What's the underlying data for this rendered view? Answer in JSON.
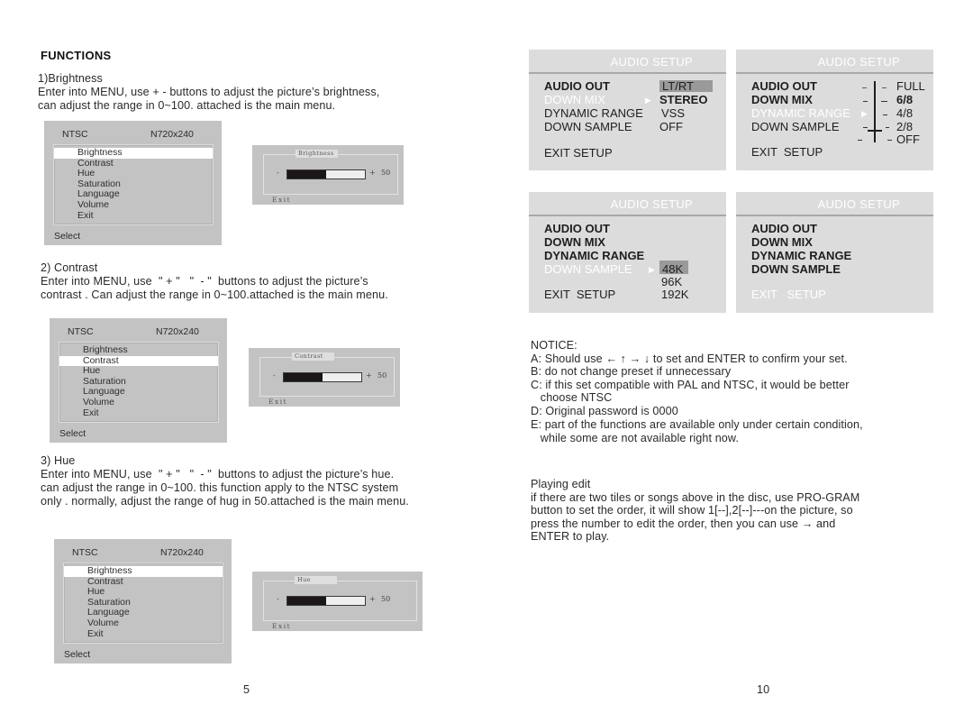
{
  "left_page": {
    "heading": "FUNCTIONS",
    "sections": [
      {
        "title": "1)Brightness",
        "lines": [
          "Enter into MENU, use + - buttons to adjust the picture’s brightness,",
          "can adjust the range in 0~100. attached is the main menu."
        ]
      },
      {
        "title": "2) Contrast",
        "lines": [
          "Enter into MENU, use  \" + \"   \"  - \"  buttons to adjust the picture’s",
          "contrast . Can adjust the range in 0~100.attached is the main menu."
        ]
      },
      {
        "title": "3) Hue",
        "lines": [
          "Enter into MENU, use  \" + \"   \"  - \"  buttons to adjust the picture’s hue.",
          "can adjust the range in 0~100. this function apply to the NTSC system",
          "only . normally, adjust the range of hug in 50.attached is the main menu."
        ]
      }
    ],
    "menus": [
      {
        "system": "NTSC",
        "resolution": "N720x240",
        "items": [
          "Brightness",
          "Contrast",
          "Hue",
          "Saturation",
          "Language",
          "Volume",
          "Exit"
        ],
        "selected": "Brightness",
        "footer": "Select",
        "slider": {
          "title": "Brightness",
          "minus": "-",
          "plus": "+",
          "value": 50,
          "value_label": "50",
          "exit": "Exit"
        }
      },
      {
        "system": "NTSC",
        "resolution": "N720x240",
        "items": [
          "Brightness",
          "Contrast",
          "Hue",
          "Saturation",
          "Language",
          "Volume",
          "Exit"
        ],
        "selected": "Contrast",
        "footer": "Select",
        "slider": {
          "title": "Contrast",
          "minus": "-",
          "plus": "+",
          "value": 50,
          "value_label": "50",
          "exit": "Exit"
        }
      },
      {
        "system": "NTSC",
        "resolution": "N720x240",
        "items": [
          "Brightness",
          "Contrast",
          "Hue",
          "Saturation",
          "Language",
          "Volume",
          "Exit"
        ],
        "selected": "Brightness",
        "footer": "Select",
        "slider": {
          "title": "Hue",
          "minus": "-",
          "plus": "+",
          "value": 50,
          "value_label": "50",
          "exit": "Exit"
        }
      }
    ],
    "page_number": "5"
  },
  "right_page": {
    "audio_panels": [
      {
        "title": "AUDIO SETUP",
        "rows": [
          "AUDIO OUT",
          "DOWN MIX",
          "DYNAMIC RANGE",
          "DOWN SAMPLE",
          "EXIT SETUP"
        ],
        "highlighted": "DOWN MIX",
        "options": [
          "LT/RT",
          "STEREO",
          "VSS",
          "OFF"
        ],
        "selected_option": "LT/RT"
      },
      {
        "title": "AUDIO SETUP",
        "rows": [
          "AUDIO OUT",
          "DOWN MIX",
          "DYNAMIC RANGE",
          "DOWN SAMPLE",
          "EXIT  SETUP"
        ],
        "highlighted": "DYNAMIC RANGE",
        "options": [
          "FULL",
          "6/8",
          "4/8",
          "2/8",
          "OFF"
        ],
        "selected_option": "6/8"
      },
      {
        "title": "AUDIO SETUP",
        "rows": [
          "AUDIO OUT",
          "DOWN MIX",
          "DYNAMIC RANGE",
          "DOWN SAMPLE",
          "EXIT  SETUP"
        ],
        "highlighted": "DOWN SAMPLE",
        "options": [
          "48K",
          "96K",
          "192K"
        ],
        "selected_option": "48K"
      },
      {
        "title": "AUDIO SETUP",
        "rows": [
          "AUDIO OUT",
          "DOWN MIX",
          "DYNAMIC RANGE",
          "DOWN SAMPLE",
          "EXIT   SETUP"
        ],
        "highlighted": "EXIT   SETUP",
        "options": [],
        "selected_option": ""
      }
    ],
    "notice": {
      "title": "NOTICE:",
      "lines": [
        "A: Should use ← ↑ → ↓ to set and ENTER to confirm your set.",
        "B: do not change preset if unnecessary",
        "C: if this set compatible with PAL and NTSC, it would be better",
        "   choose NTSC",
        "D: Original password is 0000",
        "E: part of the functions are available only under certain condition,",
        "   while some are not available right now."
      ]
    },
    "playing_edit": {
      "title": "Playing edit",
      "lines": [
        "if there are two tiles or songs above in the disc, use PRO-GRAM",
        "button to set the order, it will show 1[--],2[--]---on the picture, so",
        "press the number to edit the order, then you can use → and",
        "ENTER to play."
      ]
    },
    "page_number": "10"
  },
  "icons": {
    "arrow_right": "▶"
  }
}
